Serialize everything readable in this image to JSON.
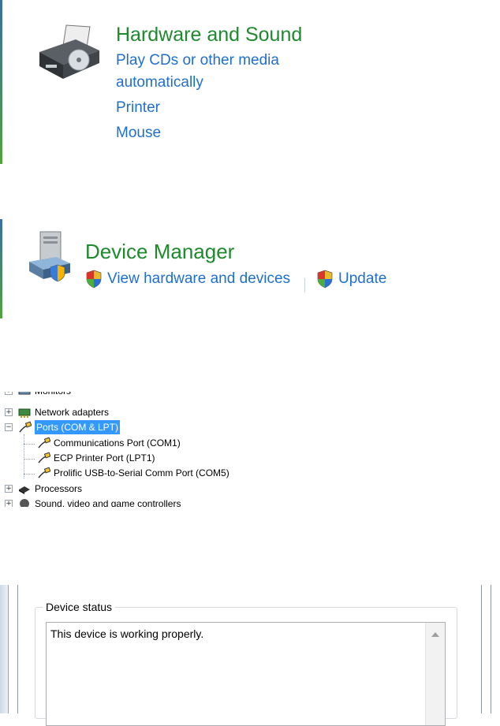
{
  "hardware_sound": {
    "title": "Hardware and Sound",
    "links": [
      "Play CDs or other media",
      "automatically",
      "Printer",
      "Mouse"
    ],
    "icon": "printer-icon"
  },
  "device_manager": {
    "title": "Device Manager",
    "tasks": [
      "View hardware and devices",
      "Update"
    ],
    "icon": "computer-icon",
    "task_icon": "uac-shield-icon"
  },
  "device_tree": {
    "partial_top": "Monitors",
    "items": {
      "network": "Network adapters",
      "ports": "Ports (COM & LPT)",
      "com1": "Communications Port (COM1)",
      "lpt1": "ECP Printer Port (LPT1)",
      "com5": "Prolific USB-to-Serial Comm Port (COM5)",
      "processors": "Processors",
      "sound": "Sound, video and game controllers"
    },
    "selected": "Ports (COM & LPT)"
  },
  "device_status": {
    "label": "Device status",
    "text": "This device is working properly."
  },
  "colors": {
    "title_green": "#1e8a2d",
    "link_blue": "#1f6fcf",
    "selection": "#3399ff"
  }
}
